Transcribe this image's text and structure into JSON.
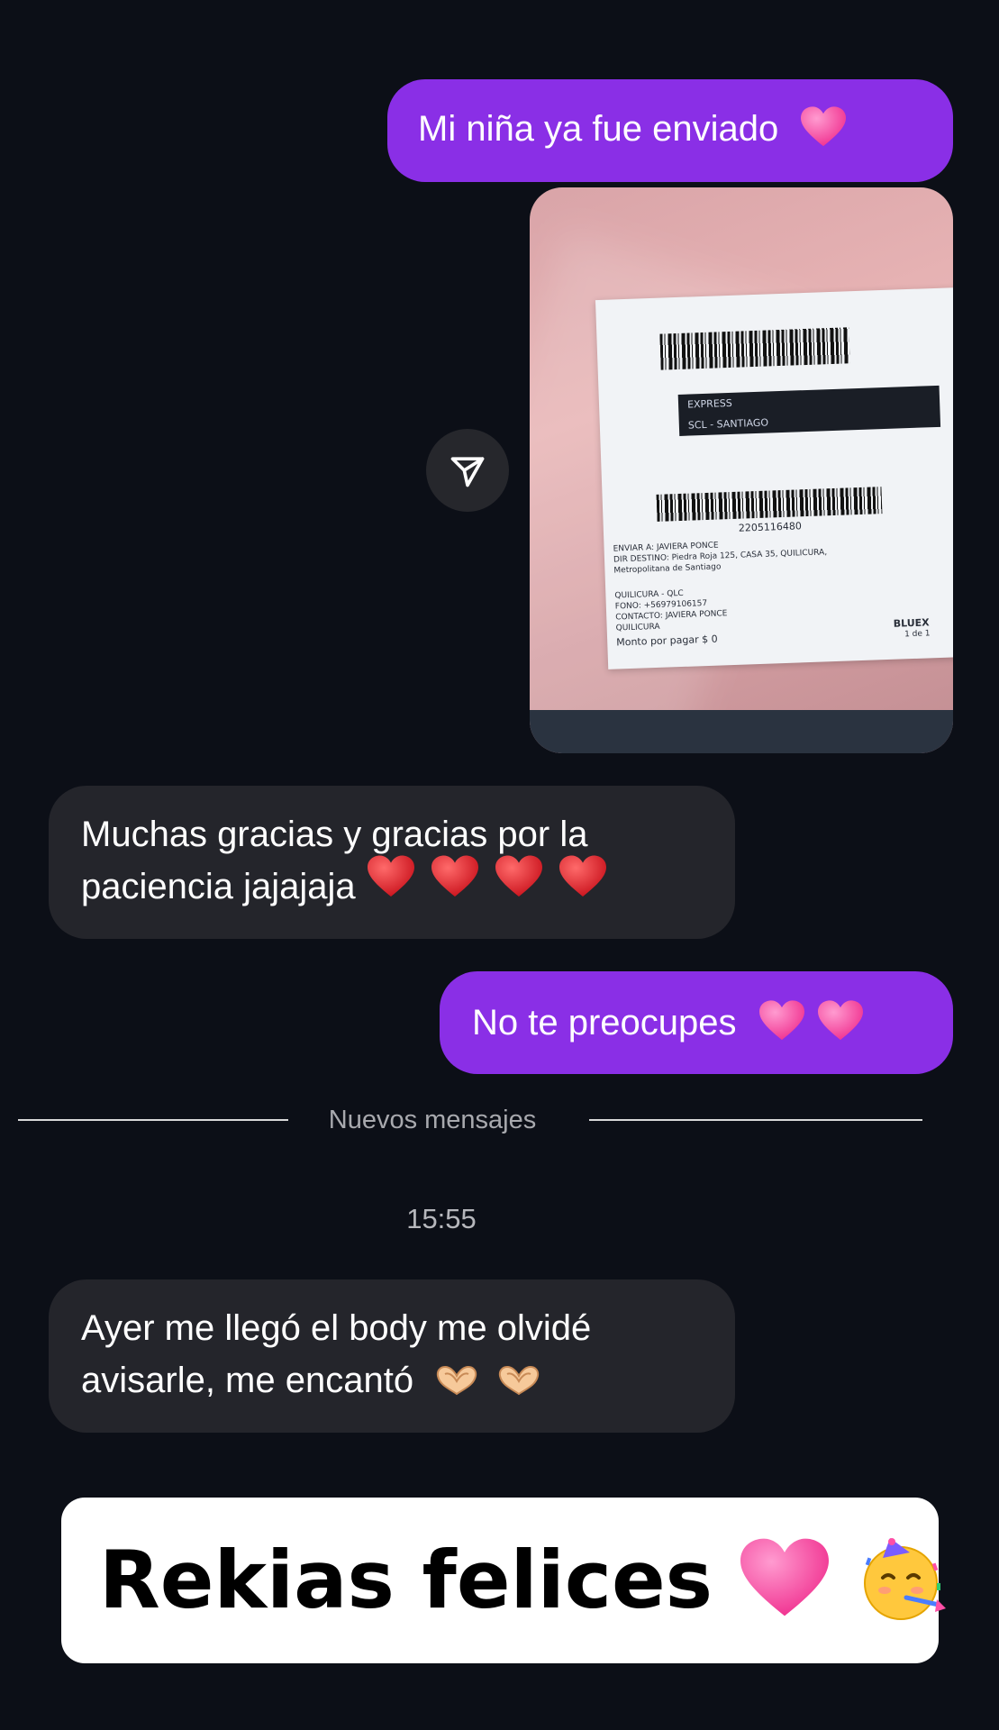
{
  "messages": {
    "m1_text": "Mi niña ya fue enviado",
    "m2_line1": "Muchas gracias y gracias por la",
    "m2_line2": "paciencia jajajaja",
    "m3_text": "No te preocupes",
    "m4_line1": "Ayer me llegó el body me olvidé",
    "m4_line2": "avisarle, me encantó"
  },
  "photo_label": {
    "service": "EXPRESS",
    "route": "SCL - SANTIAGO",
    "tracking": "2205116480",
    "line_enviar": "ENVIAR A: JAVIERA  PONCE",
    "line_dir": "DIR DESTINO: Piedra Roja 125, CASA 35, QUILICURA,",
    "line_region": "Metropolitana de Santiago",
    "line_comuna": "QUILICURA - QLC",
    "line_fono": "FONO: +56979106157",
    "line_contacto": "CONTACTO: JAVIERA  PONCE",
    "line_ciudad": "QUILICURA",
    "line_monto": "Monto por pagar $ 0",
    "brand": "BLUEX",
    "pieces": "1 de 1"
  },
  "divider": {
    "label": "Nuevos mensajes"
  },
  "timestamp": "15:55",
  "caption": {
    "text": "Rekias felices"
  },
  "colors": {
    "background": "#0c0f17",
    "outgoing_bubble": "#8a2fe6",
    "incoming_bubble": "#24252b",
    "pink_heart": "#ff4fa6",
    "red_heart": "#e01b24"
  },
  "icons": {
    "send": "paper-plane-icon",
    "pink_heart": "pink-heart-emoji",
    "red_heart": "red-heart-emoji",
    "heart_hands": "heart-hands-emoji",
    "party_face": "partying-face-emoji"
  }
}
